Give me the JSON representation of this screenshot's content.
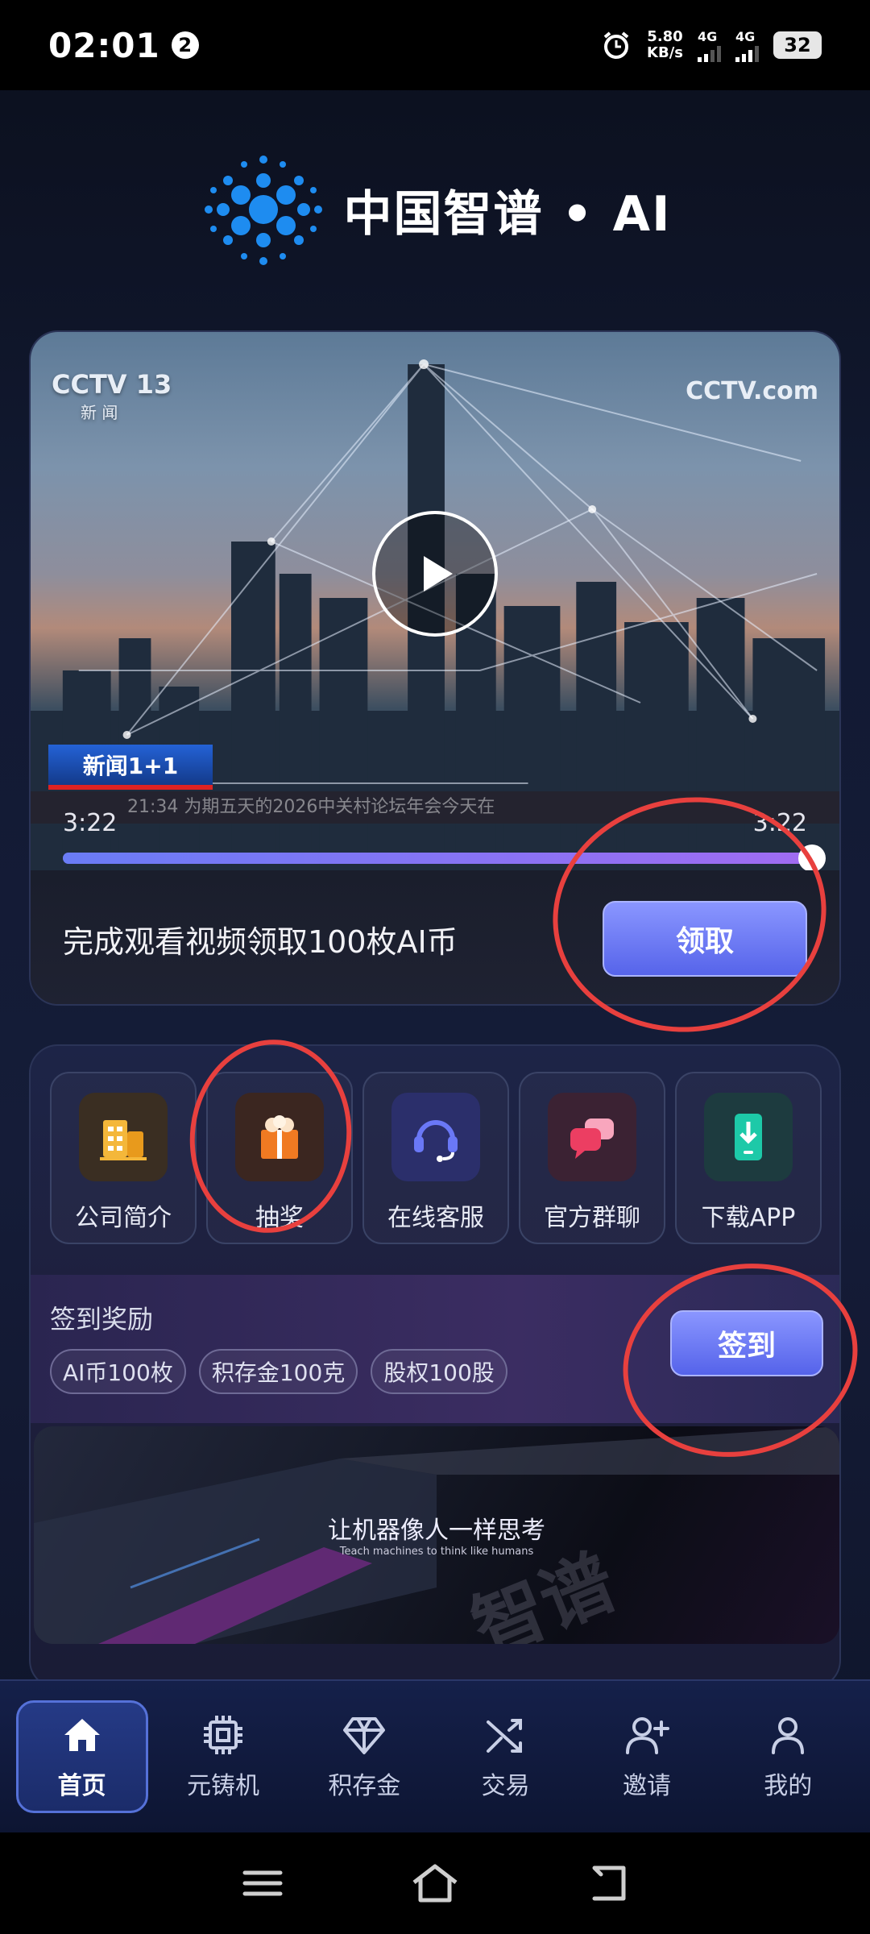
{
  "status_bar": {
    "time": "02:01",
    "notification_count": "2",
    "net_speed": "5.80",
    "net_unit": "KB/s",
    "sim1": "4G",
    "sim2": "4G",
    "battery": "32"
  },
  "logo": {
    "text": "中国智谱 • AI"
  },
  "video": {
    "channel_left": "CCTV 13",
    "channel_left_sub": "新 闻",
    "channel_right": "CCTV.com",
    "news_tag": "新闻1+1",
    "ticker": "21:34   为期五天的2026中关村论坛年会今天在",
    "current_time": "3:22",
    "total_time": "3:22",
    "progress": 1.0
  },
  "reward": {
    "text": "完成观看视频领取100枚AI币",
    "button": "领取"
  },
  "quick_menu": [
    {
      "label": "公司简介",
      "icon": "building-icon"
    },
    {
      "label": "抽奖",
      "icon": "gift-icon"
    },
    {
      "label": "在线客服",
      "icon": "headset-icon"
    },
    {
      "label": "官方群聊",
      "icon": "chat-bubbles-icon"
    },
    {
      "label": "下载APP",
      "icon": "download-phone-icon"
    }
  ],
  "signin": {
    "title": "签到奖励",
    "rewards": [
      "AI币100枚",
      "积存金100克",
      "股权100股"
    ],
    "button": "签到"
  },
  "banner": {
    "title": "让机器像人一样思考",
    "subtitle": "Teach machines to think like humans",
    "brand": "智谱"
  },
  "tabs": [
    {
      "label": "首页",
      "icon": "home-icon",
      "active": true
    },
    {
      "label": "元铸机",
      "icon": "chip-icon",
      "active": false
    },
    {
      "label": "积存金",
      "icon": "diamond-icon",
      "active": false
    },
    {
      "label": "交易",
      "icon": "shuffle-icon",
      "active": false
    },
    {
      "label": "邀请",
      "icon": "add-user-icon",
      "active": false
    },
    {
      "label": "我的",
      "icon": "user-icon",
      "active": false
    }
  ],
  "colors": {
    "accent": "#6a78f2",
    "annotation": "#e8403e",
    "background": "#121a33"
  }
}
